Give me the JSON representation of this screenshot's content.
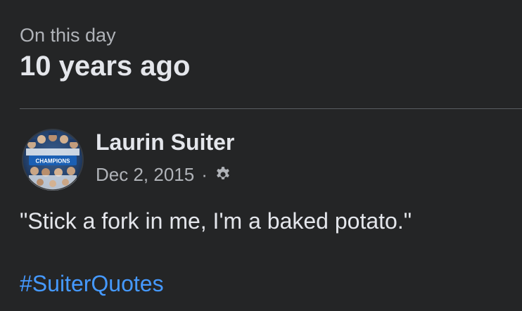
{
  "memory": {
    "label": "On this day",
    "period": "10 years ago"
  },
  "post": {
    "author": "Laurin Suiter",
    "date": "Dec 2, 2015",
    "separator": "·",
    "audience_icon": "gear-icon",
    "text": "\"Stick a fork in me, I'm a baked potato.\"",
    "hashtag": "#SuiterQuotes",
    "avatar_banner_text": "CHAMPIONS"
  },
  "colors": {
    "background": "#242526",
    "primary_text": "#e4e6eb",
    "secondary_text": "#b0b3b8",
    "link": "#4599ff",
    "divider": "#5a5d61"
  }
}
